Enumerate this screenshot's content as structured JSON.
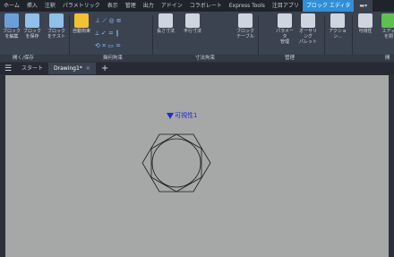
{
  "menubar": {
    "tabs": [
      "ホーム",
      "挿入",
      "注釈",
      "パラメトリック",
      "表示",
      "管理",
      "出力",
      "アドイン",
      "コラボレート",
      "Express Tools",
      "注目アプリ",
      "ブロック エディタ"
    ],
    "active_index": 11
  },
  "ribbon": {
    "tools": [
      {
        "name": "block-edit-button",
        "label": "ブロック\nを編集",
        "color": "#6aa0d8"
      },
      {
        "name": "block-save-button",
        "label": "ブロック\nを保存",
        "color": "#8ec0ea"
      },
      {
        "name": "block-test-button",
        "label": "ブロック\nをテスト",
        "color": "#8ec0ea"
      },
      {
        "name": "auto-constrain-button",
        "label": "自動拘束",
        "color": "#f2c230"
      },
      {
        "name": "horizontal-dim-button",
        "label": "長さ寸法",
        "color": "#cfd5de"
      },
      {
        "name": "aligned-dim-button",
        "label": "平行寸法",
        "color": "#cfd5de"
      },
      {
        "name": "block-table-button",
        "label": "ブロック\nテーブル",
        "color": "#cfd5de"
      },
      {
        "name": "param-manager-button",
        "label": "パラメータ\n管理",
        "color": "#cfd5de"
      },
      {
        "name": "authoring-palette-button",
        "label": "オーサリング\nパレット",
        "color": "#cfd5de"
      },
      {
        "name": "action-button",
        "label": "アクション...",
        "color": "#cfd5de"
      },
      {
        "name": "visibility-button",
        "label": "可視性",
        "color": "#cfd5de"
      },
      {
        "name": "close-editor-button",
        "label": "エディ\nを閉",
        "color": "#5fbf4f"
      }
    ],
    "panels": [
      "開く/保存",
      "幾何拘束",
      "寸法拘束",
      "管理",
      "開"
    ]
  },
  "doc_tabs": {
    "menu_label": "☰",
    "start_label": "スタート",
    "drawing_label": "Drawing1*",
    "close_label": "×",
    "add_label": "+"
  },
  "canvas": {
    "visibility_text": "可視性1"
  },
  "colors": {
    "menubar_bg": "#1f232a",
    "ribbon_bg": "#3b4250",
    "active_tab": "#2f8fd8",
    "canvas_bg": "#a6a8a7",
    "annotation_blue": "#1c2fd0"
  }
}
